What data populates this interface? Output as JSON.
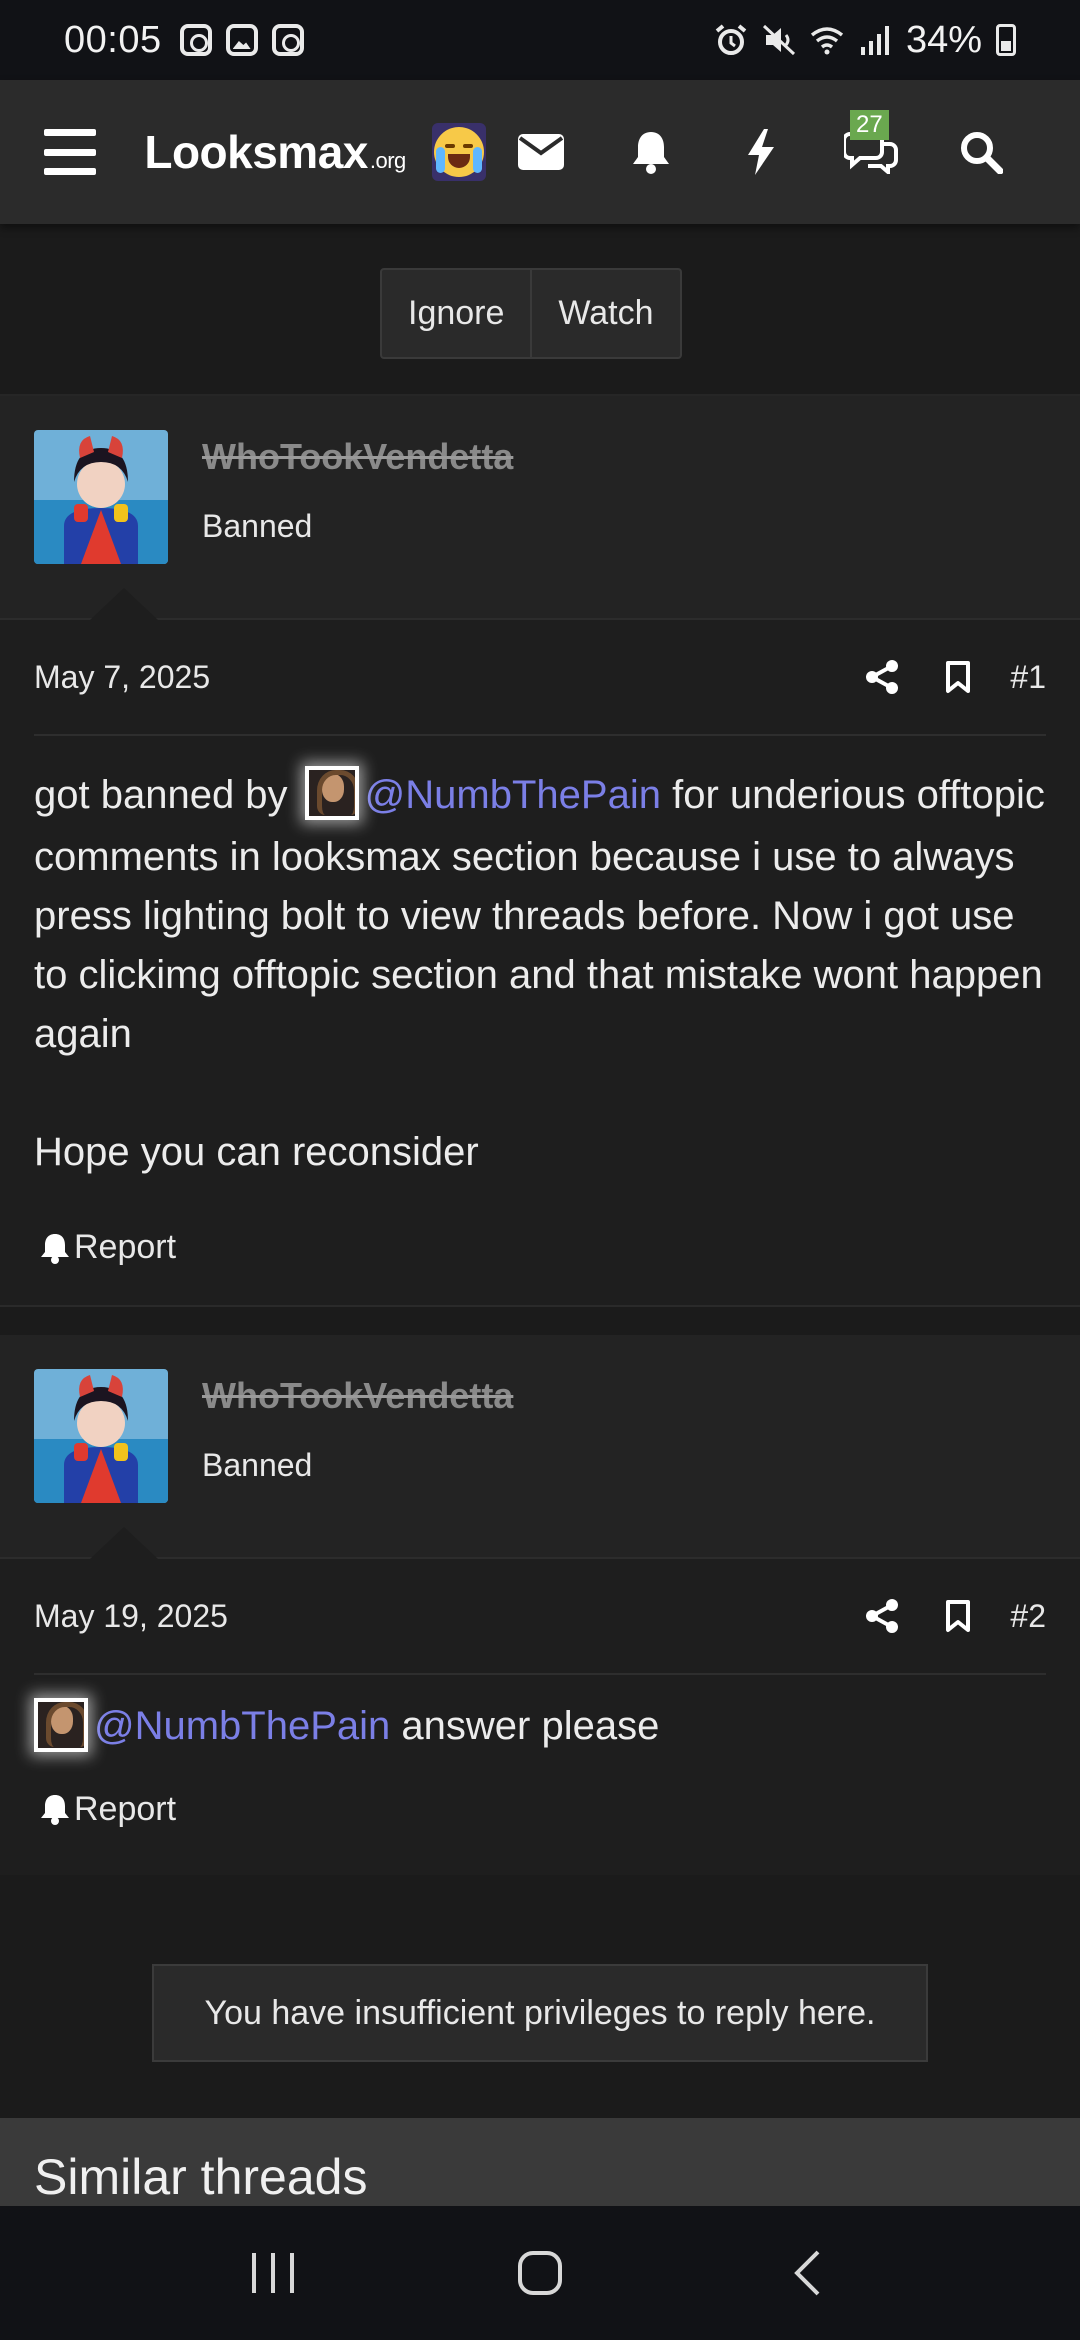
{
  "status_bar": {
    "time": "00:05",
    "battery": "34%"
  },
  "header": {
    "logo_main": "Looksmax",
    "logo_suffix": ".org",
    "conversations_badge": "27",
    "icons": [
      "menu-icon",
      "emoji-icon",
      "mail-icon",
      "bell-icon",
      "lightning-icon",
      "chat-icon",
      "search-icon"
    ]
  },
  "thread_actions": {
    "ignore_label": "Ignore",
    "watch_label": "Watch"
  },
  "posts": [
    {
      "username": "WhoTookVendetta",
      "user_title": "Banned",
      "date": "May 7, 2025",
      "number": "#1",
      "text_before": "got banned by ",
      "mention": "@NumbThePain",
      "text_after": " for underious offtopic comments in looksmax section because i use to always press lighting bolt to view threads before. Now i got use to clickimg offtopic section and that mistake wont happen again",
      "paragraph2": "Hope you can reconsider",
      "report_label": "Report"
    },
    {
      "username": "WhoTookVendetta",
      "user_title": "Banned",
      "date": "May 19, 2025",
      "number": "#2",
      "text_before": "",
      "mention": "@NumbThePain",
      "text_after": " answer please",
      "report_label": "Report"
    }
  ],
  "reply_notice": "You have insufficient privileges to reply here.",
  "similar_threads_title": "Similar threads",
  "colors": {
    "mention": "#7b7fe6",
    "badge": "#6aa84f",
    "header_bg": "#2b2b2b",
    "page_bg": "#1b1b1b"
  }
}
